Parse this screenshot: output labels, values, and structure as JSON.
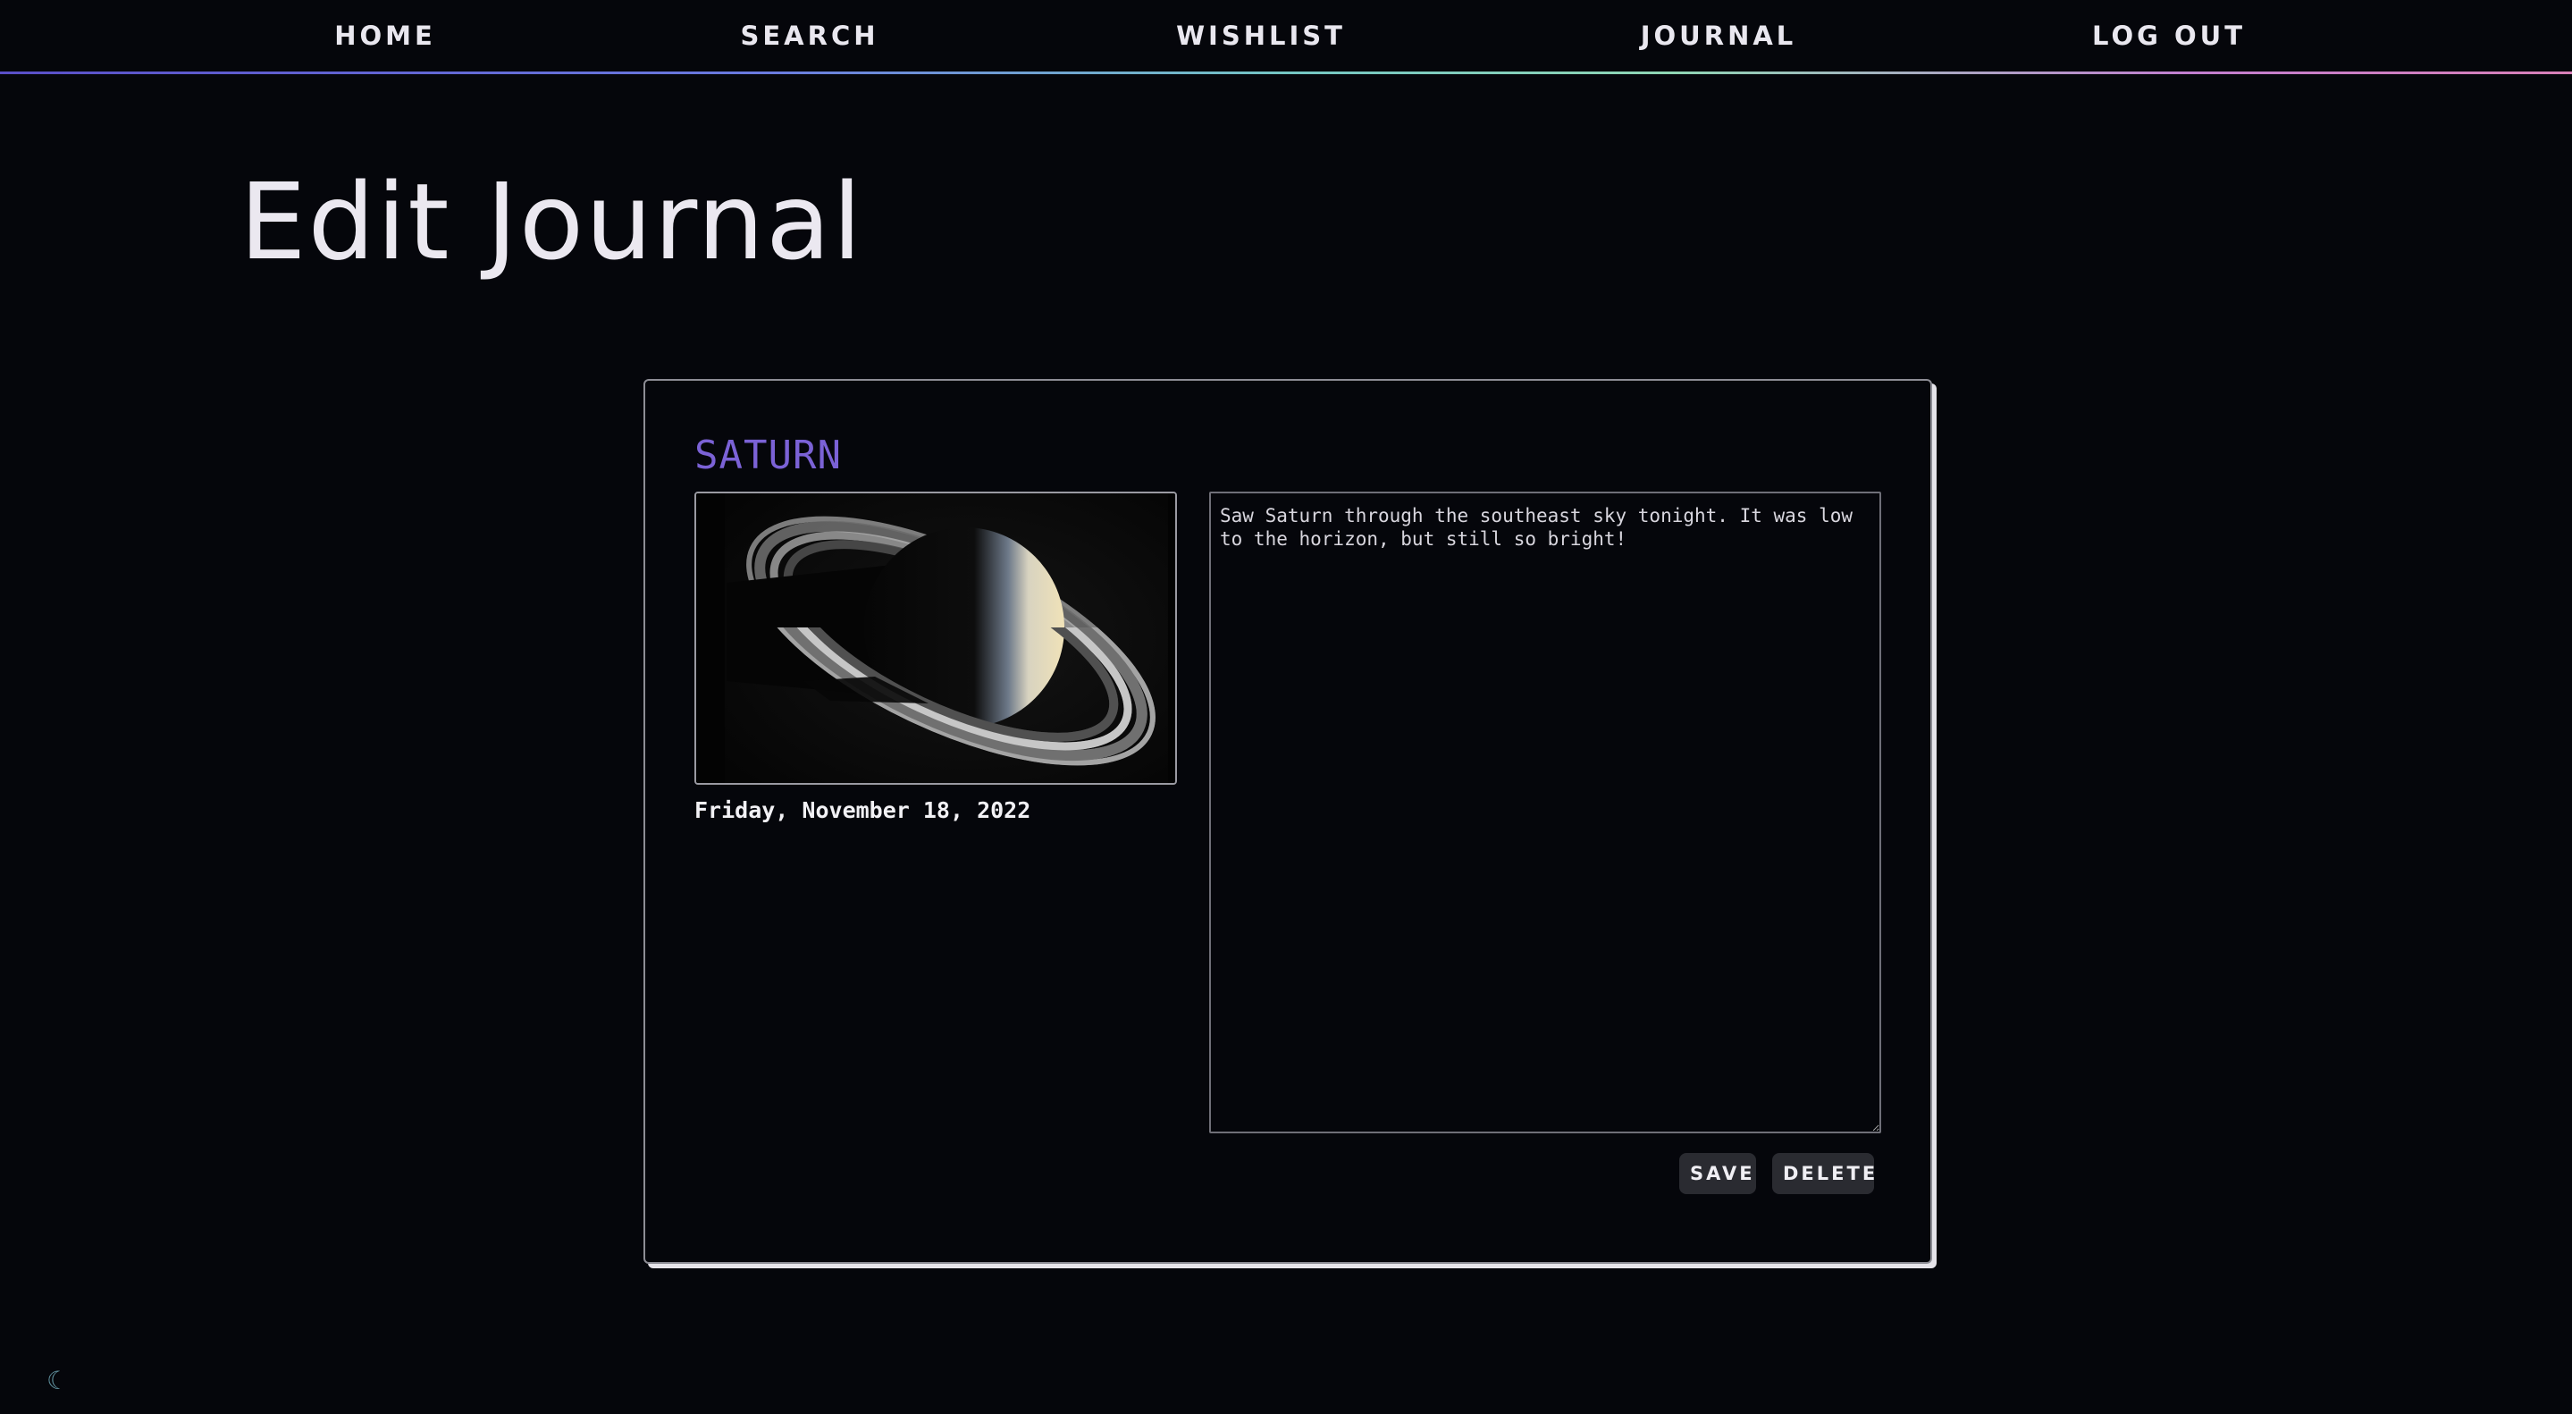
{
  "nav": {
    "items": [
      {
        "label": "HOME"
      },
      {
        "label": "SEARCH"
      },
      {
        "label": "WISHLIST"
      },
      {
        "label": "JOURNAL"
      },
      {
        "label": "LOG OUT"
      }
    ]
  },
  "page": {
    "title": "Edit Journal"
  },
  "entry": {
    "name": "SATURN",
    "date": "Friday, November 18, 2022",
    "notes": "Saw Saturn through the southeast sky tonight. It was low to the horizon, but still so bright!"
  },
  "actions": {
    "save_label": "SAVE",
    "delete_label": "DELETE"
  },
  "theme": {
    "toggle_icon": "moon-icon",
    "toggle_glyph": "☾"
  },
  "colors": {
    "background": "#05060b",
    "accent": "#7b62d6",
    "button": "#2a2b31"
  }
}
